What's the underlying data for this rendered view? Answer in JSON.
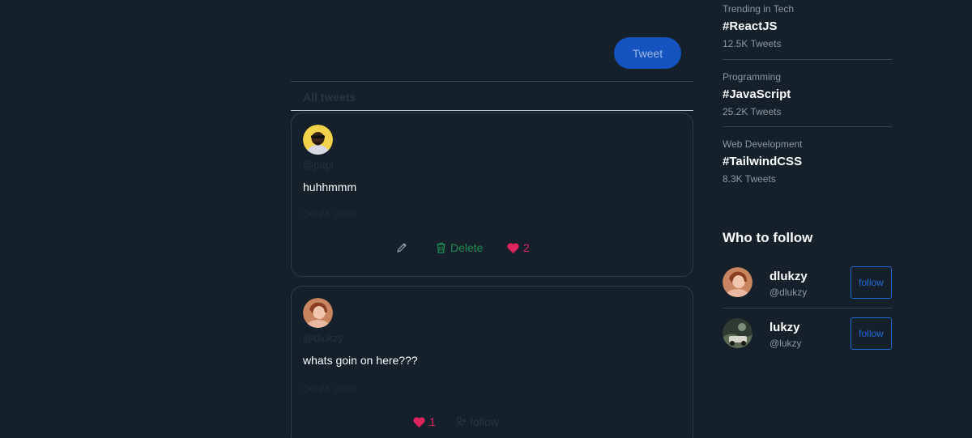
{
  "composer": {
    "tweet_button": "Tweet"
  },
  "feed": {
    "tab_label": "All tweets",
    "tweets": [
      {
        "handle": "@papi",
        "content": "huhhmmm",
        "date": "Oct 24, 2020",
        "delete_label": "Delete",
        "likes": "2",
        "avatar_icon": "avatar-papi"
      },
      {
        "handle": "@dlukzy",
        "content": "whats goin on here???",
        "date": "Oct 24, 2020",
        "likes": "1",
        "follow_label": "follow",
        "avatar_icon": "avatar-dlukzy"
      }
    ]
  },
  "sidebar": {
    "trends": [
      {
        "category": "Trending in Tech",
        "tag": "#ReactJS",
        "count": "12.5K Tweets"
      },
      {
        "category": "Programming",
        "tag": "#JavaScript",
        "count": "25.2K Tweets"
      },
      {
        "category": "Web Development",
        "tag": "#TailwindCSS",
        "count": "8.3K Tweets"
      }
    ],
    "who_to_follow": {
      "title": "Who to follow",
      "users": [
        {
          "name": "dlukzy",
          "handle": "@dlukzy",
          "follow_label": "follow"
        },
        {
          "name": "lukzy",
          "handle": "@lukzy",
          "follow_label": "follow"
        }
      ]
    }
  },
  "colors": {
    "background": "#15202b",
    "accent": "#1554c0",
    "like": "#e0245e",
    "delete": "#1f8a4c"
  }
}
